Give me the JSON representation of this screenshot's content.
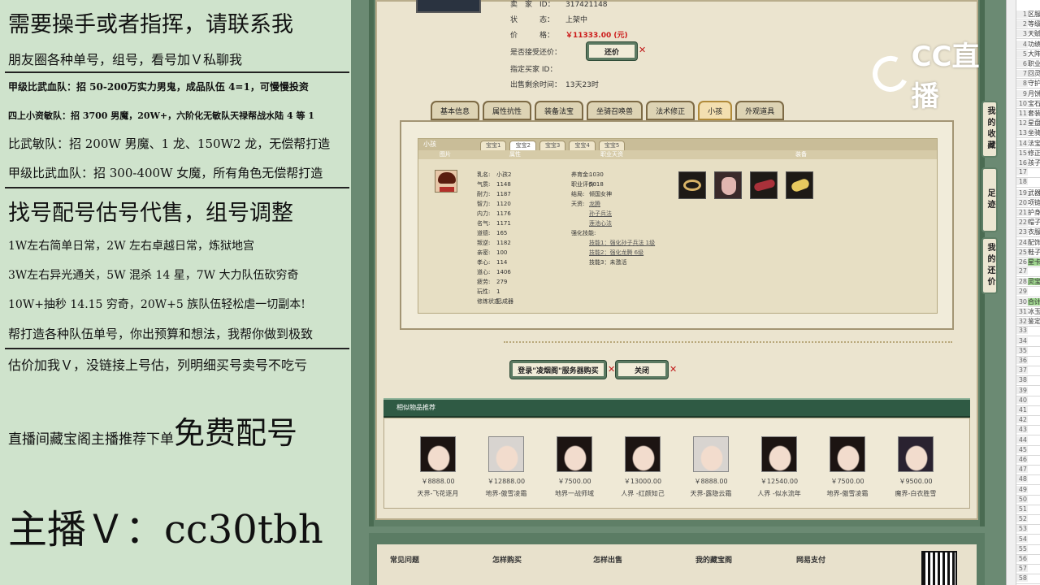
{
  "left_overlay": {
    "lines": [
      "需要操手或者指挥，请联系我",
      "朋友圈各种单号，组号，看号加Ｖ私聊我",
      "甲级比武血队：招 50-200万实力男鬼，成品队伍 4=1，可慢慢投资",
      "四上小资敏队：招 3700 男魔，20W+，六阶化无敏队天禄帮战水陆 4 等 1",
      "比武敏队：招 200W 男魔、1 龙、150W2 龙，无偿帮打造",
      "甲级比武血队：招 300-400W 女魔，所有角色无偿帮打造",
      "找号配号估号代售，组号调整",
      "1W左右简单日常，2W 左右卓越日常，炼狱地宫",
      "3W左右异光通关，5W 混杀 14 星，7W 大力队伍砍穷奇",
      "10W+抽秒 14.15 穷奇，20W+5 族队伍轻松虐一切副本!",
      "帮打造各种队伍单号，你出预算和想法，我帮你做到极致",
      "估价加我Ｖ，没链接上号估，列明细买号卖号不吃亏"
    ],
    "promo_prefix": "直播间藏宝阁主播推荐下单",
    "promo_big": "免费配号",
    "contact": "主播Ｖ：cc30tbh"
  },
  "listing": {
    "seller_id_label": "卖　家　ID：",
    "seller_id": "317421148",
    "status_label": "状　　　态：",
    "status": "上架中",
    "price_label": "价　　　格：",
    "price": "￥11333.00 (元)",
    "counter_label": "是否接受还价：",
    "counter_button": "还价",
    "buyer_label": "指定买家 ID：",
    "remain_label": "出售剩余时间：",
    "remain": "13天23时"
  },
  "tabs": [
    "基本信息",
    "属性抗性",
    "装备法宝",
    "坐骑召唤兽",
    "法术修正",
    "小孩",
    "外观道具"
  ],
  "active_tab": 5,
  "child_panel": {
    "title": "小孩",
    "subtabs": [
      "宝宝1",
      "宝宝2",
      "宝宝3",
      "宝宝4",
      "宝宝5"
    ],
    "active_subtab": 1,
    "col_headers": [
      "图片",
      "属性",
      "职业天资",
      "装备"
    ],
    "stats_left": [
      {
        "k": "乳名:",
        "v": "小孩2"
      },
      {
        "k": "气质:",
        "v": "1148"
      },
      {
        "k": "耐力:",
        "v": "1187"
      },
      {
        "k": "智力:",
        "v": "1120"
      },
      {
        "k": "内力:",
        "v": "1176"
      },
      {
        "k": "名气:",
        "v": "1171"
      },
      {
        "k": "道德:",
        "v": "165"
      },
      {
        "k": "叛逆:",
        "v": "1182"
      },
      {
        "k": "亲密:",
        "v": "100"
      },
      {
        "k": "孝心:",
        "v": "114"
      },
      {
        "k": "道心:",
        "v": "1406"
      },
      {
        "k": "疲劳:",
        "v": "279"
      },
      {
        "k": "玩性:",
        "v": "1"
      },
      {
        "k": "修炼状态:",
        "v": "已成器"
      }
    ],
    "stats_mid": [
      {
        "k": "养育金:",
        "v": "1030",
        "link": false
      },
      {
        "k": "职业评价:",
        "v": "5018",
        "link": false
      },
      {
        "k": "结局:",
        "v": "倾国女神",
        "link": false
      },
      {
        "k": "天资:",
        "v": "龙腾",
        "link": true
      },
      {
        "k": "",
        "v": "孙子兵法",
        "link": true
      },
      {
        "k": "",
        "v": "莲池心法",
        "link": true
      },
      {
        "k": "强化技能:",
        "v": "",
        "link": false
      },
      {
        "k": "",
        "v": "技能1：强化孙子兵法 1级",
        "link": true
      },
      {
        "k": "",
        "v": "技能2：强化龙腾 6级",
        "link": true
      },
      {
        "k": "",
        "v": "技能3：未激活",
        "link": false
      }
    ]
  },
  "actions": {
    "login_buy": "登录\"凌烟阁\"服务器购买",
    "close": "关闭"
  },
  "recommend": {
    "title": "相似物品推荐",
    "items": [
      {
        "price": "￥8888.00",
        "name": "天界-飞花逐月"
      },
      {
        "price": "￥12888.00",
        "name": "地界-傲雪凌霜"
      },
      {
        "price": "￥7500.00",
        "name": "地界一战师域"
      },
      {
        "price": "￥13000.00",
        "name": "人界 -红颜知己"
      },
      {
        "price": "￥8888.00",
        "name": "天界-露隐云霜"
      },
      {
        "price": "￥12540.00",
        "name": "人界 -似水流年"
      },
      {
        "price": "￥7500.00",
        "name": "地界-傲雪凌霜"
      },
      {
        "price": "￥9500.00",
        "name": "魔界-白衣胜雪"
      }
    ]
  },
  "footer": {
    "cols": [
      "常见问题",
      "怎样购买",
      "怎样出售",
      "我的藏宝阁",
      "网易支付"
    ]
  },
  "side_tabs": [
    "我的收藏",
    "足迹",
    "我的还价"
  ],
  "watermark": "CC直播",
  "sheet_rows": [
    {
      "n": "1",
      "t": "区服"
    },
    {
      "n": "2",
      "t": "等级"
    },
    {
      "n": "3",
      "t": "天赋"
    },
    {
      "n": "4",
      "t": "功绩"
    },
    {
      "n": "5",
      "t": "大阵"
    },
    {
      "n": "6",
      "t": "职业"
    },
    {
      "n": "7",
      "t": "回灵"
    },
    {
      "n": "8",
      "t": "守护"
    },
    {
      "n": "9",
      "t": "月饼"
    },
    {
      "n": "10",
      "t": "宝石"
    },
    {
      "n": "11",
      "t": "套装"
    },
    {
      "n": "12",
      "t": "星盘"
    },
    {
      "n": "13",
      "t": "坐骑"
    },
    {
      "n": "14",
      "t": "法宝"
    },
    {
      "n": "15",
      "t": "修正"
    },
    {
      "n": "16",
      "t": "孩子"
    },
    {
      "n": "17",
      "t": ""
    },
    {
      "n": "18",
      "t": ""
    },
    {
      "n": "19",
      "t": "武器"
    },
    {
      "n": "20",
      "t": "项链"
    },
    {
      "n": "21",
      "t": "护身"
    },
    {
      "n": "22",
      "t": "帽子"
    },
    {
      "n": "23",
      "t": "衣服"
    },
    {
      "n": "24",
      "t": "配饰"
    },
    {
      "n": "25",
      "t": "鞋子"
    },
    {
      "n": "26",
      "t": "星卡",
      "green": true
    },
    {
      "n": "27",
      "t": ""
    },
    {
      "n": "28",
      "t": "灵宝",
      "green": true
    },
    {
      "n": "29",
      "t": ""
    },
    {
      "n": "30",
      "t": "合计",
      "green": true
    },
    {
      "n": "31",
      "t": "冰玉"
    },
    {
      "n": "32",
      "t": "鉴定"
    },
    {
      "n": "33",
      "t": ""
    },
    {
      "n": "34",
      "t": ""
    },
    {
      "n": "35",
      "t": ""
    },
    {
      "n": "36",
      "t": ""
    },
    {
      "n": "37",
      "t": ""
    },
    {
      "n": "38",
      "t": ""
    },
    {
      "n": "39",
      "t": ""
    },
    {
      "n": "40",
      "t": ""
    },
    {
      "n": "41",
      "t": ""
    },
    {
      "n": "42",
      "t": ""
    },
    {
      "n": "43",
      "t": ""
    },
    {
      "n": "44",
      "t": ""
    },
    {
      "n": "45",
      "t": ""
    },
    {
      "n": "46",
      "t": ""
    },
    {
      "n": "47",
      "t": ""
    },
    {
      "n": "48",
      "t": ""
    },
    {
      "n": "49",
      "t": ""
    },
    {
      "n": "50",
      "t": ""
    },
    {
      "n": "51",
      "t": ""
    },
    {
      "n": "52",
      "t": ""
    },
    {
      "n": "53",
      "t": ""
    },
    {
      "n": "54",
      "t": ""
    },
    {
      "n": "55",
      "t": ""
    },
    {
      "n": "56",
      "t": ""
    },
    {
      "n": "57",
      "t": ""
    },
    {
      "n": "58",
      "t": ""
    }
  ]
}
